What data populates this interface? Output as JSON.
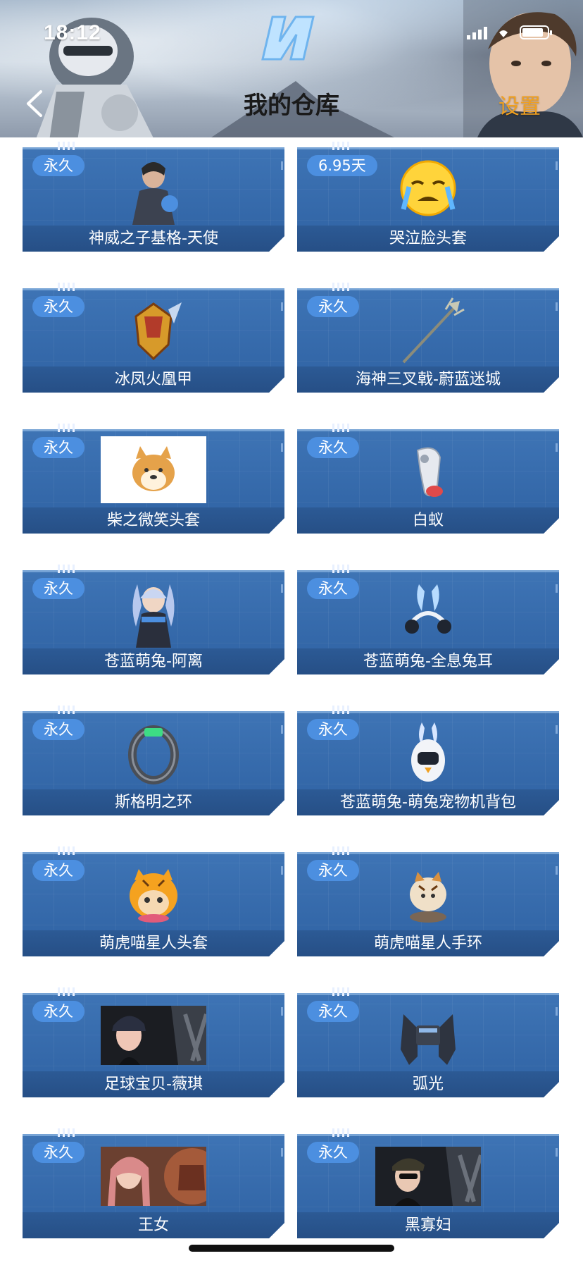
{
  "status_bar": {
    "time": "18:12",
    "battery_level": 0.85
  },
  "header": {
    "title": "我的仓库",
    "settings_label": "设置"
  },
  "items": [
    {
      "badge": "永久",
      "name": "神威之子基格-天使",
      "icon": "character-angel-icon"
    },
    {
      "badge": "6.95天",
      "name": "哭泣脸头套",
      "icon": "crying-face-emoji-icon"
    },
    {
      "badge": "永久",
      "name": "冰凤火凰甲",
      "icon": "phoenix-armor-icon"
    },
    {
      "badge": "永久",
      "name": "海神三叉戟-蔚蓝迷城",
      "icon": "trident-icon"
    },
    {
      "badge": "永久",
      "name": "柴之微笑头套",
      "icon": "shiba-dog-head-icon"
    },
    {
      "badge": "永久",
      "name": "白蚁",
      "icon": "white-ant-weapon-icon"
    },
    {
      "badge": "永久",
      "name": "苍蓝萌兔-阿离",
      "icon": "bunny-girl-character-icon"
    },
    {
      "badge": "永久",
      "name": "苍蓝萌兔-全息兔耳",
      "icon": "bunny-ears-headphones-icon"
    },
    {
      "badge": "永久",
      "name": "斯格明之环",
      "icon": "ring-bracelet-icon"
    },
    {
      "badge": "永久",
      "name": "苍蓝萌兔-萌兔宠物机背包",
      "icon": "bunny-robot-backpack-icon"
    },
    {
      "badge": "永久",
      "name": "萌虎喵星人头套",
      "icon": "tiger-cat-helmet-icon"
    },
    {
      "badge": "永久",
      "name": "萌虎喵星人手环",
      "icon": "tiger-cat-bracelet-icon"
    },
    {
      "badge": "永久",
      "name": "足球宝贝-薇琪",
      "icon": "football-girl-banner-icon"
    },
    {
      "badge": "永久",
      "name": "弧光",
      "icon": "arc-drone-icon"
    },
    {
      "badge": "永久",
      "name": "王女",
      "icon": "princess-banner-icon"
    },
    {
      "badge": "永久",
      "name": "黑寡妇",
      "icon": "black-widow-banner-icon"
    }
  ]
}
